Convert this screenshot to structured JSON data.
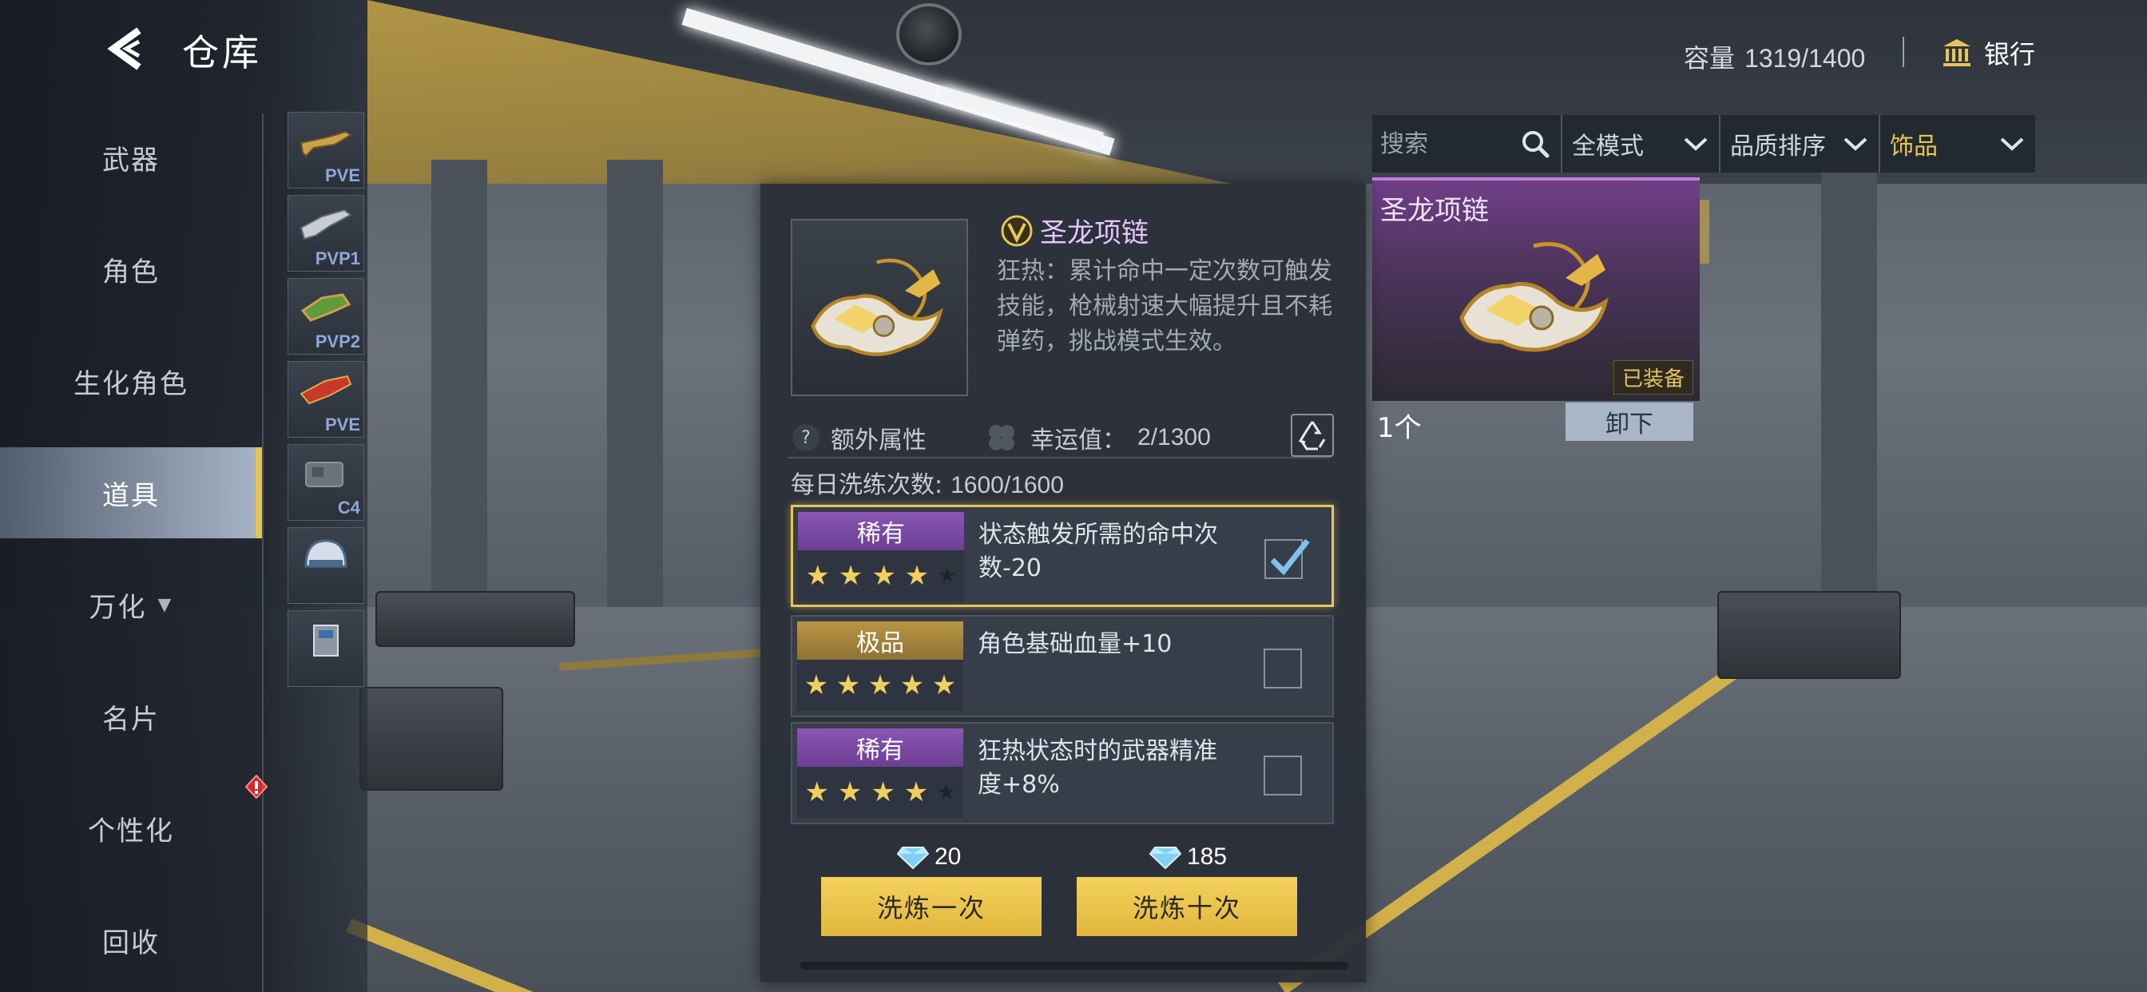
{
  "header": {
    "title": "仓库",
    "capacity_label": "容量",
    "capacity_value": "1319/1400",
    "bank_label": "银行"
  },
  "nav": {
    "items": [
      {
        "label": "武器"
      },
      {
        "label": "角色"
      },
      {
        "label": "生化角色"
      },
      {
        "label": "道具",
        "active": true
      },
      {
        "label": "万化",
        "has_dropdown": true
      },
      {
        "label": "名片"
      },
      {
        "label": "个性化",
        "has_alert": true
      },
      {
        "label": "回收"
      }
    ],
    "categories": [
      {
        "tag": "PVE"
      },
      {
        "tag": "PVP1"
      },
      {
        "tag": "PVP2"
      },
      {
        "tag": "PVE"
      },
      {
        "tag": "C4"
      },
      {
        "tag": ""
      },
      {
        "tag": ""
      }
    ]
  },
  "filters": {
    "search_placeholder": "搜索",
    "mode": "全模式",
    "sort": "品质排序",
    "category": "饰品"
  },
  "equipped": {
    "name": "圣龙项链",
    "status": "已装备",
    "count": "1个",
    "unequip_label": "卸下"
  },
  "item": {
    "name": "圣龙项链",
    "description": "狂热：累计命中一定次数可触发技能，枪械射速大幅提升且不耗弹药，挑战模式生效。",
    "extra_attr_label": "额外属性",
    "luck_label": "幸运值：",
    "luck_value": "2/1300",
    "daily_label": "每日洗练次数:",
    "daily_value": "1600/1600"
  },
  "attributes": [
    {
      "rarity": "稀有",
      "rarity_class": "rare",
      "stars": 4,
      "text": "状态触发所需的命中次数-20",
      "checked": true
    },
    {
      "rarity": "极品",
      "rarity_class": "epic",
      "stars": 5,
      "text": "角色基础血量+10",
      "checked": false
    },
    {
      "rarity": "稀有",
      "rarity_class": "rare",
      "stars": 4,
      "text": "狂热状态时的武器精准度+8%",
      "checked": false
    }
  ],
  "refine": {
    "once_cost": "20",
    "once_label": "洗炼一次",
    "ten_cost": "185",
    "ten_label": "洗炼十次"
  },
  "colors": {
    "accent_gold": "#e6c65a",
    "rare_purple": "#8a56b3",
    "epic_gold": "#b89645"
  }
}
